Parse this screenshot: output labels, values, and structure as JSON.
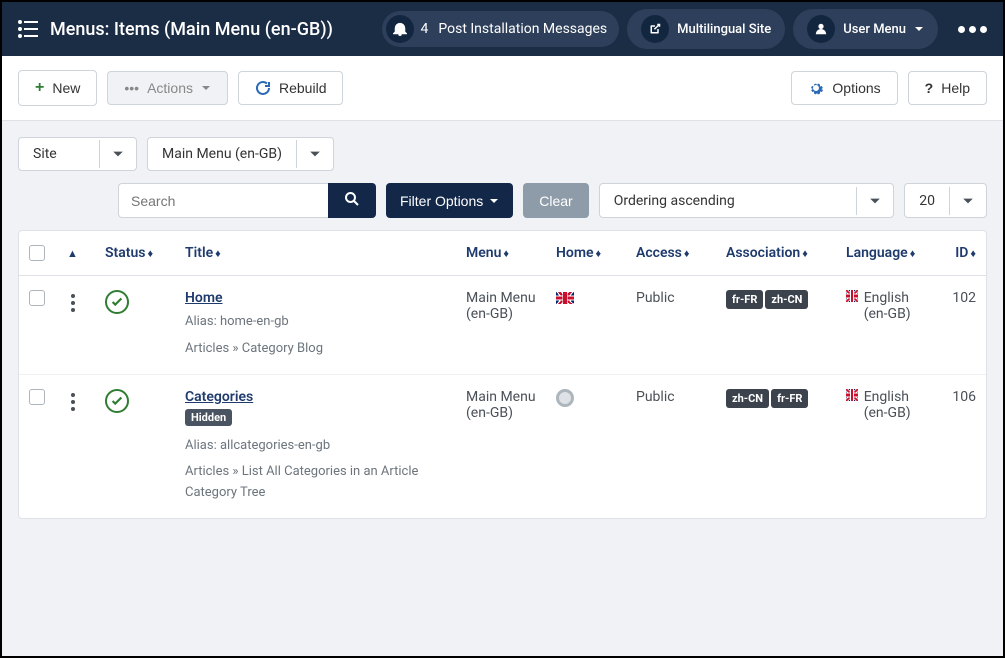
{
  "header": {
    "title": "Menus: Items (Main Menu (en-GB))",
    "notif_count": "4",
    "notif_label": "Post Installation Messages",
    "multilingual_label": "Multilingual Site",
    "user_menu_label": "User Menu"
  },
  "toolbar": {
    "new_label": "New",
    "actions_label": "Actions",
    "rebuild_label": "Rebuild",
    "options_label": "Options",
    "help_label": "Help"
  },
  "filters": {
    "site_label": "Site",
    "menu_label": "Main Menu (en-GB)",
    "search_placeholder": "Search",
    "filter_options_label": "Filter Options",
    "clear_label": "Clear",
    "ordering_label": "Ordering ascending",
    "limit_label": "20"
  },
  "columns": {
    "status": "Status",
    "title": "Title",
    "menu": "Menu",
    "home": "Home",
    "access": "Access",
    "association": "Association",
    "language": "Language",
    "id": "ID"
  },
  "rows": [
    {
      "title": "Home",
      "alias": "Alias: home-en-gb",
      "path": "Articles » Category Blog",
      "hidden": false,
      "menu": "Main Menu (en-GB)",
      "home_flag": true,
      "access": "Public",
      "assoc": [
        "fr-FR",
        "zh-CN"
      ],
      "language": "English (en-GB)",
      "id": "102"
    },
    {
      "title": "Categories",
      "alias": "Alias: allcategories-en-gb",
      "path": "Articles » List All Categories in an Article Category Tree",
      "hidden": true,
      "hidden_label": "Hidden",
      "menu": "Main Menu (en-GB)",
      "home_flag": false,
      "access": "Public",
      "assoc": [
        "zh-CN",
        "fr-FR"
      ],
      "language": "English (en-GB)",
      "id": "106"
    }
  ]
}
